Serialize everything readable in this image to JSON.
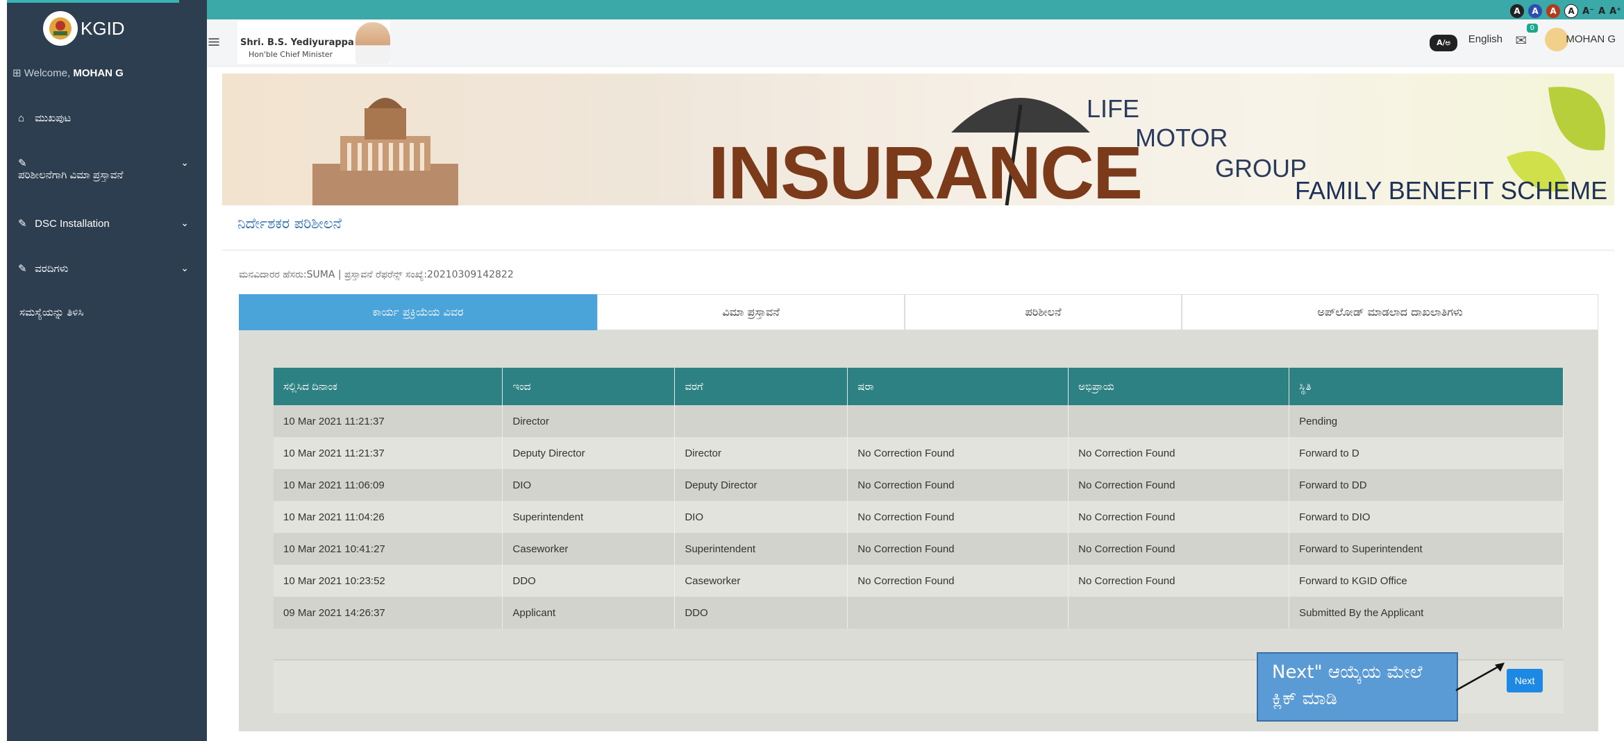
{
  "sidebar": {
    "brand": "KGID",
    "welcome_prefix": "Welcome, ",
    "welcome_user": "MOHAN G",
    "items": [
      {
        "label": "ಮುಖಪುಟ"
      },
      {
        "label": "ಪರಿಶೀಲನೆಗಾಗಿ ವಿಮಾ ಪ್ರಸ್ತಾವನೆ"
      },
      {
        "label": "DSC Installation"
      },
      {
        "label": "ವರದಿಗಳು"
      },
      {
        "label": "ಸಮಸ್ಯೆಯನ್ನು ತಿಳಿಸಿ"
      }
    ]
  },
  "topbar": {
    "cm_name": "Shri. B.S. Yediyurappa",
    "cm_title": "Hon'ble Chief Minister",
    "a11y": [
      "A",
      "A",
      "A",
      "A",
      "A⁻",
      "A",
      "A⁺"
    ],
    "lang_icon": "A/ಅ",
    "language": "English",
    "mail_count": "0",
    "user": "MOHAN G"
  },
  "banner": {
    "word": "INSURANCE",
    "lines": [
      "LIFE",
      "MOTOR",
      "GROUP",
      "FAMILY BENEFIT SCHEME"
    ]
  },
  "page": {
    "title": "ನಿರ್ದೇಶಕರ ಪರಿಶೀಲನೆ",
    "applicant_line": "ಮನವಿದಾರರ ಹೆಸರು:SUMA | ಪ್ರಸ್ತಾವನೆ ರೆಫರೆನ್ಸ್ ಸಂಖ್ಯೆ:20210309142822",
    "tabs": [
      "ಕಾರ್ಯ ಪ್ರಕ್ರಿಯೆಯ ವಿವರ",
      "ವಿಮಾ ಪ್ರಸ್ತಾವನೆ",
      "ಪರಿಶೀಲನೆ",
      "ಅಪ್‌ಲೋಡ್ ಮಾಡಲಾದ ದಾಖಲಾತಿಗಳು"
    ],
    "active_tab": 0
  },
  "table": {
    "headers": [
      "ಸಲ್ಲಿಸಿದ ದಿನಾಂಕ",
      "ಇಂದ",
      "ವರಗೆ",
      "ಷರಾ",
      "ಅಭಿಪ್ರಾಯ",
      "ಸ್ಥಿತಿ"
    ],
    "rows": [
      [
        "10 Mar 2021 11:21:37",
        "Director",
        "",
        "",
        "",
        "Pending"
      ],
      [
        "10 Mar 2021 11:21:37",
        "Deputy Director",
        "Director",
        "No Correction Found",
        "No Correction Found",
        "Forward to D"
      ],
      [
        "10 Mar 2021 11:06:09",
        "DIO",
        "Deputy Director",
        "No Correction Found",
        "No Correction Found",
        "Forward to DD"
      ],
      [
        "10 Mar 2021 11:04:26",
        "Superintendent",
        "DIO",
        "No Correction Found",
        "No Correction Found",
        "Forward to DIO"
      ],
      [
        "10 Mar 2021 10:41:27",
        "Caseworker",
        "Superintendent",
        "No Correction Found",
        "No Correction Found",
        "Forward to Superintendent"
      ],
      [
        "10 Mar 2021 10:23:52",
        "DDO",
        "Caseworker",
        "No Correction Found",
        "No Correction Found",
        "Forward to KGID Office"
      ],
      [
        "09 Mar 2021 14:26:37",
        "Applicant",
        "DDO",
        "",
        "",
        "Submitted By the Applicant"
      ]
    ]
  },
  "actions": {
    "next": "Next",
    "callout": "Next\" ಆಯ್ಕೆಯ ಮೇಲೆ ಕ್ಲಿಕ್ ಮಾಡಿ"
  }
}
